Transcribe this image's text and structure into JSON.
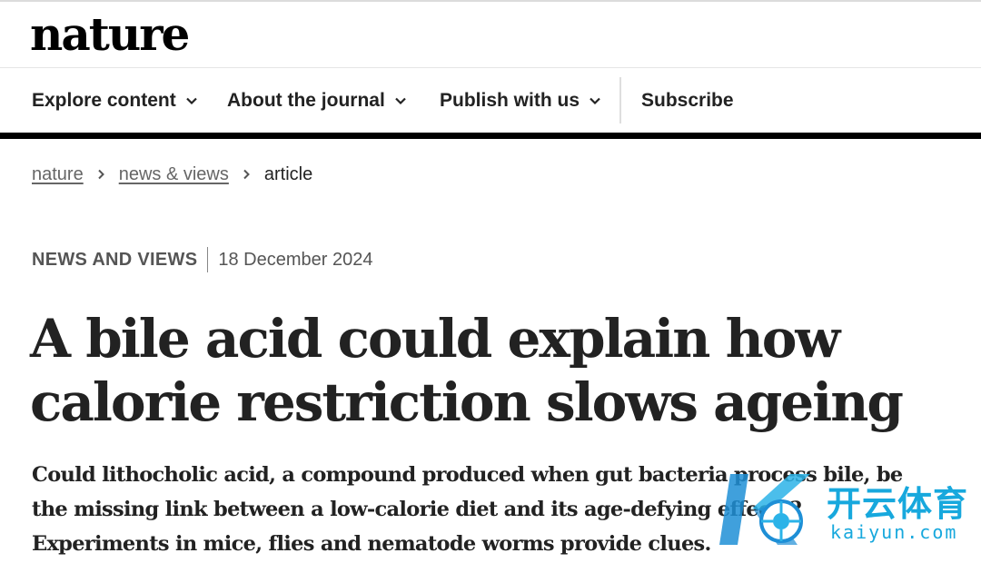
{
  "brand": {
    "logo_text": "nature"
  },
  "nav": {
    "items": [
      {
        "label": "Explore content",
        "icon": "chevron-down-icon"
      },
      {
        "label": "About the journal",
        "icon": "chevron-down-icon"
      },
      {
        "label": "Publish with us",
        "icon": "chevron-down-icon"
      }
    ],
    "subscribe_label": "Subscribe"
  },
  "breadcrumb": [
    {
      "label": "nature",
      "link": true
    },
    {
      "label": "news & views",
      "link": true
    },
    {
      "label": "article",
      "link": false
    }
  ],
  "article": {
    "type": "NEWS AND VIEWS",
    "date": "18 December 2024",
    "title": "A bile acid could explain how calorie restriction slows ageing",
    "standfirst": "Could lithocholic acid, a compound produced when gut bacteria process bile, be the missing link between a low-calorie diet and its age-defying effects? Experiments in mice, flies and nematode worms provide clues."
  },
  "watermark": {
    "text_cn": "开云体育",
    "text_en": "kaiyun.com",
    "icon": "kaiyun-logo-icon"
  },
  "colors": {
    "text": "#222222",
    "muted": "#666666",
    "bar": "#000000",
    "watermark": "#17a8dd"
  }
}
